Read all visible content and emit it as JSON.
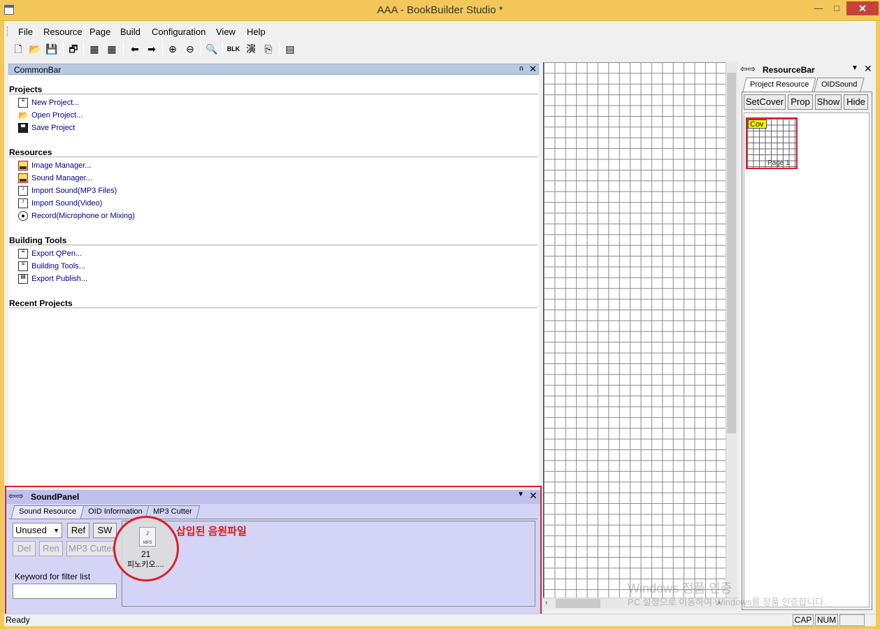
{
  "window": {
    "title": "AAA - BookBuilder Studio *",
    "minimize": "—",
    "maximize": "□",
    "close": "✕"
  },
  "menu": [
    "File",
    "Resource",
    "Page",
    "Build",
    "Configuration",
    "View",
    "Help"
  ],
  "toolbar_icons": [
    "new-icon",
    "open-icon",
    "save-icon",
    "properties-icon",
    "image-manager-icon",
    "sound-manager-icon",
    "back-icon",
    "forward-icon",
    "zoom-in-icon",
    "zoom-out-icon",
    "find-icon",
    "blk-icon",
    "script-icon",
    "export-icon",
    "publish-icon"
  ],
  "commonbar": {
    "title": "CommonBar",
    "pin": "ᴨ",
    "close": "✕",
    "sections": {
      "projects": {
        "title": "Projects",
        "items": [
          "New Project...",
          "Open Project...",
          "Save Project"
        ]
      },
      "resources": {
        "title": "Resources",
        "items": [
          "Image Manager...",
          "Sound Manager...",
          "Import Sound(MP3 Files)",
          "Import Sound(Video)",
          "Record(Microphone or Mixing)"
        ]
      },
      "building": {
        "title": "Building Tools",
        "items": [
          "Export QPen...",
          "Building Tools...",
          "Export Publish..."
        ]
      },
      "recent": {
        "title": "Recent Projects"
      }
    }
  },
  "soundpanel": {
    "title": "SoundPanel",
    "tabs": [
      "Sound Resource",
      "OID Information",
      "MP3 Cutter"
    ],
    "filter_select": "Unused",
    "buttons": {
      "ref": "Ref",
      "sw": "SW",
      "del": "Del",
      "ren": "Ren",
      "mp3cutter": "MP3 Cutter"
    },
    "keyword_label": "Keyword for filter list",
    "keyword_value": "",
    "sound_item": {
      "icon_label": "MP3",
      "number": "21",
      "name": "피노키오...."
    },
    "annotation": "삽입된 음원파일"
  },
  "resourcebar": {
    "title": "ResourceBar",
    "tabs": [
      "Project Resource",
      "OIDSound"
    ],
    "buttons": [
      "SetCover",
      "Prop",
      "Show",
      "Hide"
    ],
    "page": {
      "badge": "Cov",
      "label": "Page 1"
    }
  },
  "watermark": {
    "line1": "Windows 정품 인증",
    "line2": "PC 설정으로 이동하여 Windows를 정품 인증합니다."
  },
  "status": {
    "text": "Ready",
    "cap": "CAP",
    "num": "NUM"
  }
}
